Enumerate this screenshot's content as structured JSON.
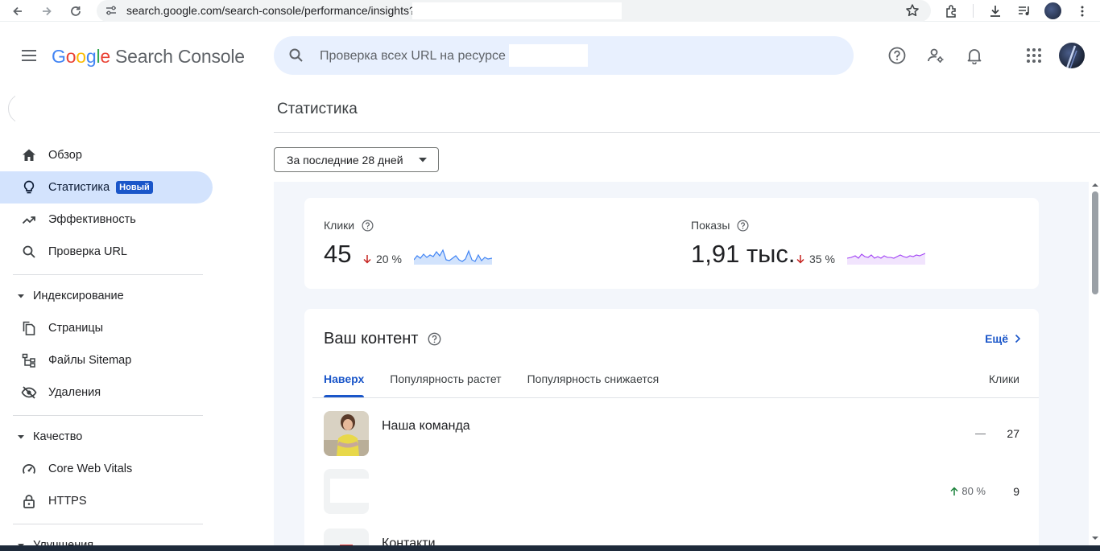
{
  "browser": {
    "url": "search.google.com/search-console/performance/insights?",
    "icons": [
      "back-icon",
      "forward-icon",
      "reload-icon",
      "tune-icon",
      "star-icon",
      "extensions-icon",
      "download-icon",
      "media-icon",
      "profile-avatar",
      "kebab-menu-icon"
    ]
  },
  "header": {
    "logo": {
      "g1": "G",
      "o1": "o",
      "o2": "o",
      "g2": "g",
      "l": "l",
      "e": "e",
      "product": "Search Console"
    },
    "search_placeholder": "Проверка всех URL на ресурсе",
    "icons": [
      "help-icon",
      "users-settings-icon",
      "notifications-icon",
      "apps-grid-icon",
      "account-avatar"
    ]
  },
  "sidebar": {
    "items": [
      {
        "label": "Обзор",
        "icon": "home-icon"
      },
      {
        "label": "Статистика",
        "icon": "lightbulb-icon",
        "badge": "Новый",
        "active": true
      },
      {
        "label": "Эффективность",
        "icon": "trending-up-icon"
      },
      {
        "label": "Проверка URL",
        "icon": "search-icon"
      }
    ],
    "sections": [
      {
        "label": "Индексирование",
        "items": [
          {
            "label": "Страницы",
            "icon": "pages-icon"
          },
          {
            "label": "Файлы Sitemap",
            "icon": "sitemap-icon"
          },
          {
            "label": "Удаления",
            "icon": "visibility-off-icon"
          }
        ]
      },
      {
        "label": "Качество",
        "items": [
          {
            "label": "Core Web Vitals",
            "icon": "speed-icon"
          },
          {
            "label": "HTTPS",
            "icon": "lock-icon"
          }
        ]
      },
      {
        "label": "Улучшения",
        "items": []
      }
    ]
  },
  "main": {
    "title": "Статистика",
    "date_filter": "За последние 28 дней",
    "metrics": [
      {
        "label": "Клики",
        "value": "45",
        "change": "20 %",
        "direction": "down",
        "spark_color": "#4285f4"
      },
      {
        "label": "Показы",
        "value": "1,91 тыс.",
        "change": "35 %",
        "direction": "down",
        "spark_color": "#a142f4"
      }
    ],
    "content": {
      "title": "Ваш контент",
      "more": "Ещё",
      "tabs": [
        "Наверх",
        "Популярность растет",
        "Популярность снижается"
      ],
      "active_tab": "Наверх",
      "column": "Клики",
      "rows": [
        {
          "title": "Наша команда",
          "change": "—",
          "value": "27",
          "trend": "flat"
        },
        {
          "title": "",
          "change": "80 %",
          "value": "9",
          "trend": "up"
        },
        {
          "title": "Контакти",
          "change": "",
          "value": "",
          "trend": ""
        }
      ]
    }
  },
  "colors": {
    "accent": "#1a56c9",
    "active_nav": "#d3e3fd",
    "search_bg": "#e8f0fe",
    "down": "#c5221f",
    "up": "#188038"
  }
}
